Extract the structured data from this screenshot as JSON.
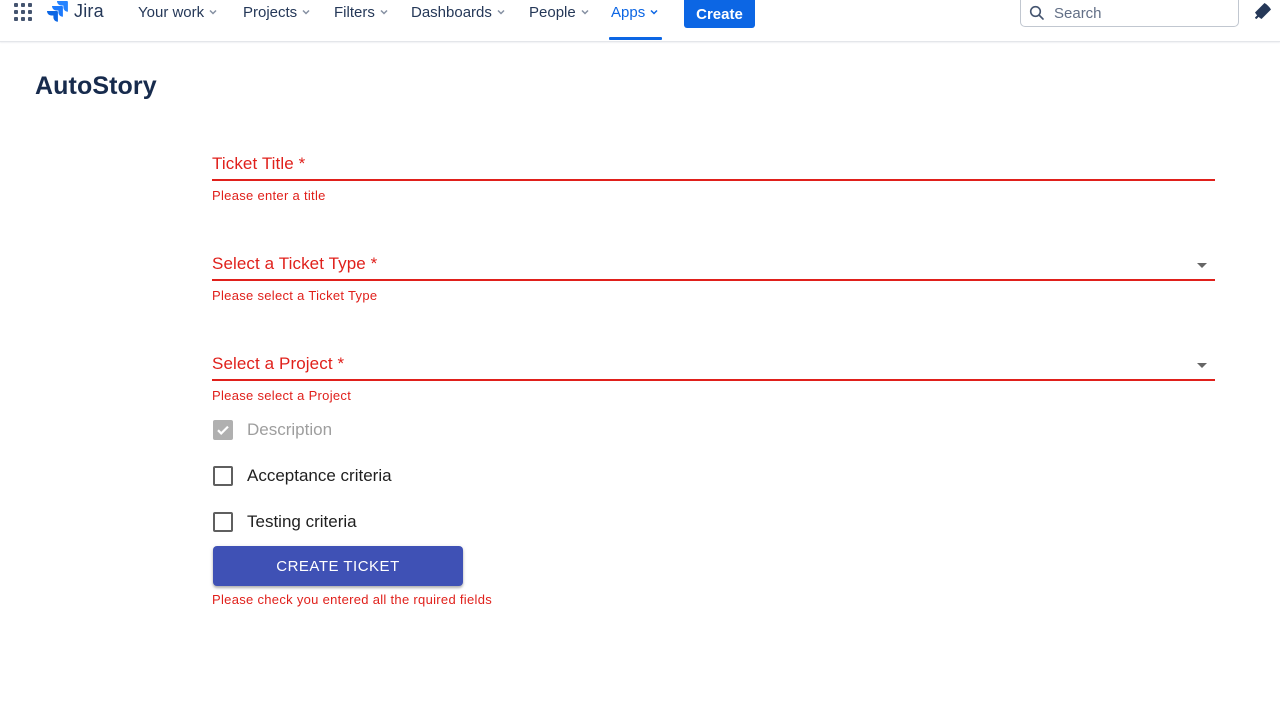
{
  "app": {
    "logo_text": "Jira"
  },
  "nav": {
    "items": [
      {
        "label": "Your work"
      },
      {
        "label": "Projects"
      },
      {
        "label": "Filters"
      },
      {
        "label": "Dashboards"
      },
      {
        "label": "People"
      },
      {
        "label": "Apps"
      }
    ],
    "active": "Apps",
    "create_label": "Create",
    "search_placeholder": "Search"
  },
  "page": {
    "title": "AutoStory"
  },
  "form": {
    "ticket_title": {
      "label": "Ticket Title *",
      "error": "Please enter a title"
    },
    "ticket_type": {
      "label": "Select a Ticket Type *",
      "error": "Please select a Ticket Type"
    },
    "project": {
      "label": "Select a Project *",
      "error": "Please select a Project"
    },
    "options": [
      {
        "label": "Description",
        "checked": true,
        "disabled": true
      },
      {
        "label": "Acceptance criteria",
        "checked": false,
        "disabled": false
      },
      {
        "label": "Testing criteria",
        "checked": false,
        "disabled": false
      }
    ],
    "submit_label": "CREATE TICKET",
    "submit_error": "Please check you entered all the rquired fields"
  },
  "colors": {
    "accent": "#0c66e4",
    "error": "#e0201b",
    "button": "#3f51b5"
  }
}
